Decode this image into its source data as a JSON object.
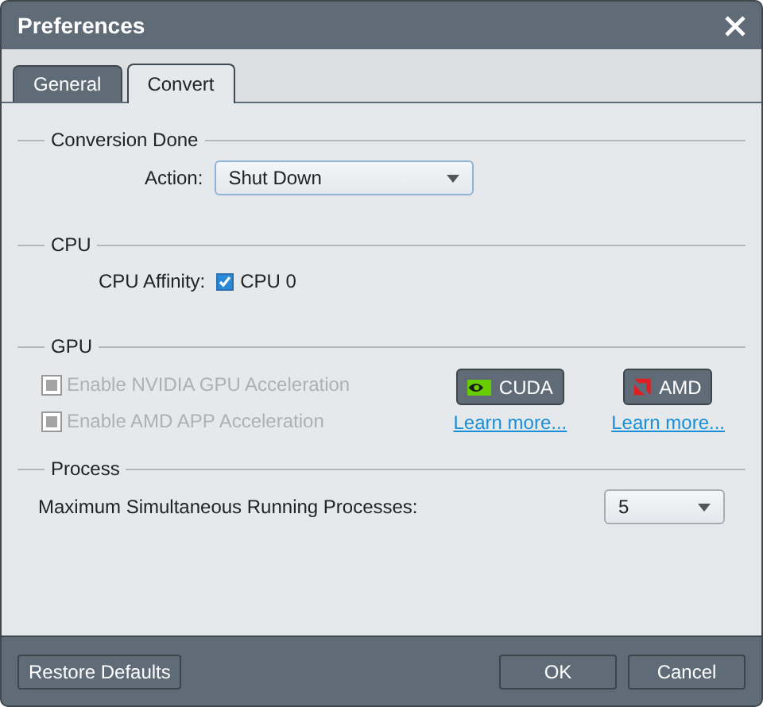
{
  "window": {
    "title": "Preferences"
  },
  "tabs": [
    {
      "label": "General",
      "selected": false
    },
    {
      "label": "Convert",
      "selected": true
    }
  ],
  "conversion_done": {
    "title": "Conversion Done",
    "action_label": "Action:",
    "action_value": "Shut Down"
  },
  "cpu": {
    "title": "CPU",
    "affinity_label": "CPU Affinity:",
    "checkbox": {
      "label": "CPU 0",
      "checked": true
    }
  },
  "gpu": {
    "title": "GPU",
    "options": [
      {
        "label": "Enable NVIDIA GPU Acceleration",
        "disabled": true
      },
      {
        "label": "Enable AMD APP Acceleration",
        "disabled": true
      }
    ],
    "vendors": [
      {
        "kind": "nvidia",
        "label": "CUDA",
        "link": "Learn more..."
      },
      {
        "kind": "amd",
        "label": "AMD",
        "link": "Learn more..."
      }
    ]
  },
  "process": {
    "title": "Process",
    "label": "Maximum Simultaneous Running Processes:",
    "value": "5"
  },
  "footer": {
    "left_button": "Restore Defaults",
    "buttons": [
      "OK",
      "Cancel"
    ]
  }
}
